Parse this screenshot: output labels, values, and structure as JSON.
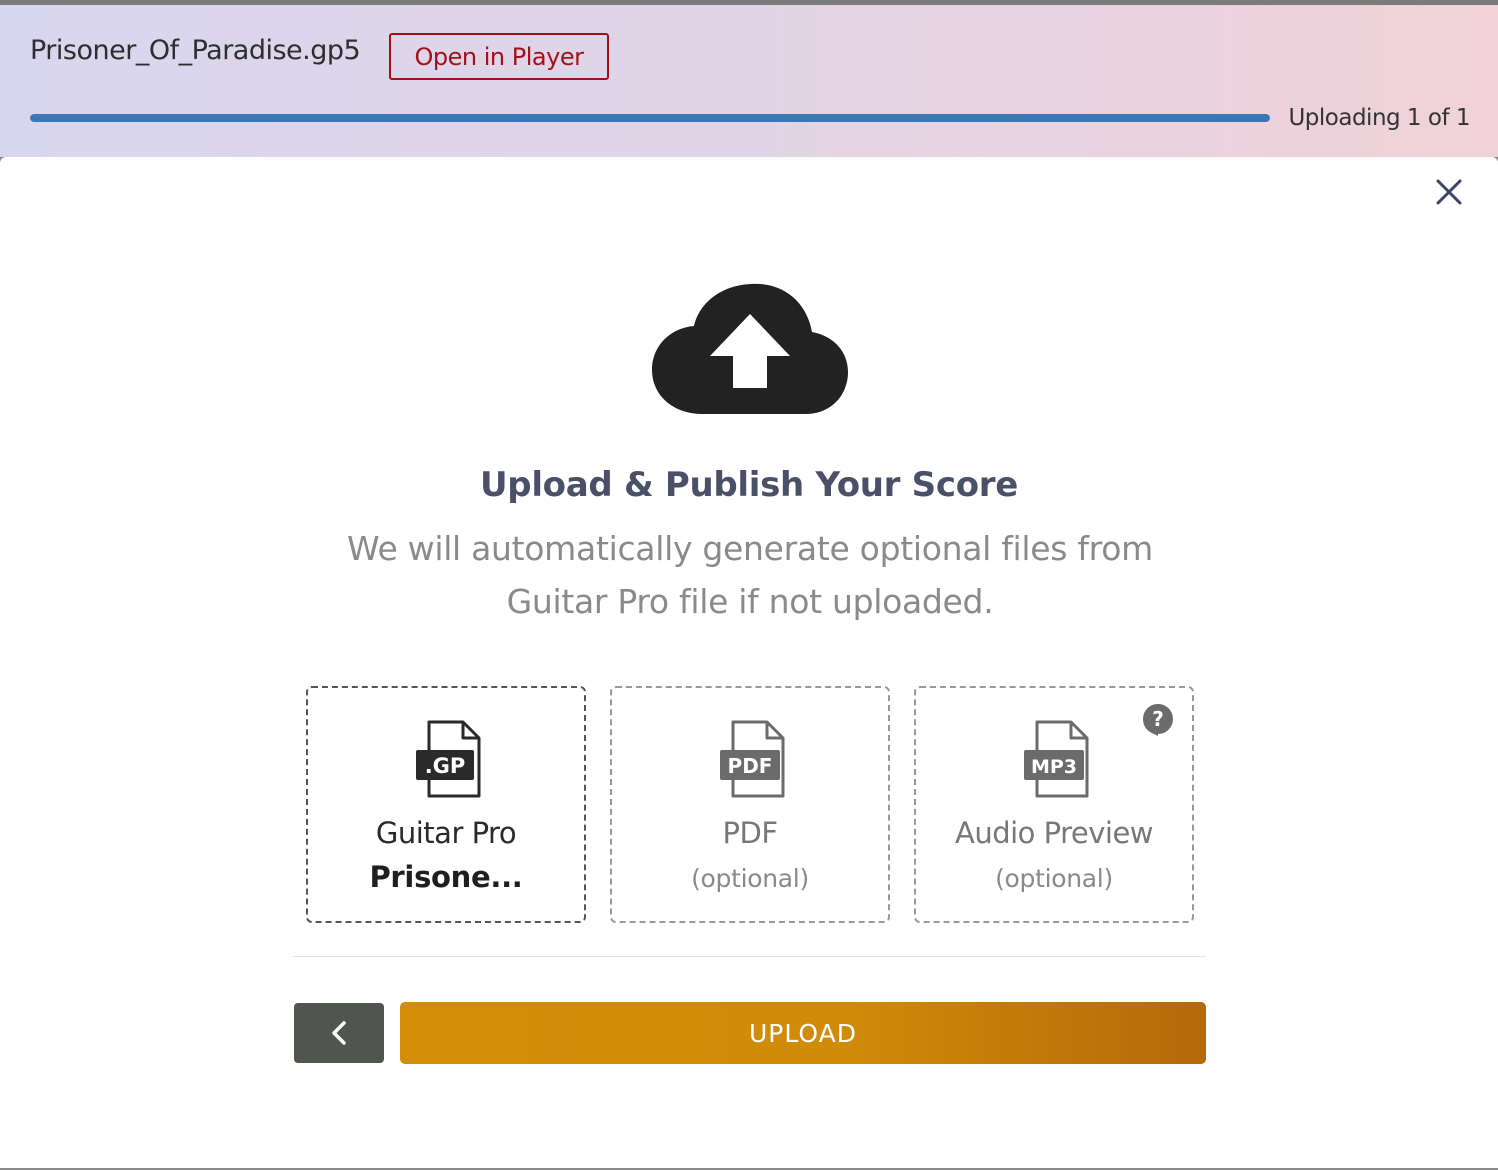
{
  "upload_bar": {
    "file_name": "Prisoner_Of_Paradise.gp5",
    "open_button_label": "Open in Player",
    "progress_fraction": 1.0,
    "status": "Uploading 1 of 1"
  },
  "modal": {
    "title": "Upload & Publish Your Score",
    "subtitle": "We will automatically generate optional files from Guitar Pro file if not uploaded.",
    "tiles": [
      {
        "icon": "gp-file-icon",
        "badge": ".GP",
        "label": "Guitar Pro",
        "sub": "Prisone..."
      },
      {
        "icon": "pdf-file-icon",
        "badge": "PDF",
        "label": "PDF",
        "sub": "(optional)"
      },
      {
        "icon": "mp3-file-icon",
        "badge": "MP3",
        "label": "Audio Preview",
        "sub": "(optional)",
        "help_icon": "question-circle-icon"
      }
    ],
    "upload_button_label": "UPLOAD",
    "back_icon": "chevron-left-icon",
    "close_icon": "close-icon"
  },
  "colors": {
    "accent_red": "#a4101a",
    "progress_blue": "#3a78b5",
    "upload_orange": "#d28e09",
    "back_button": "#50564f"
  }
}
